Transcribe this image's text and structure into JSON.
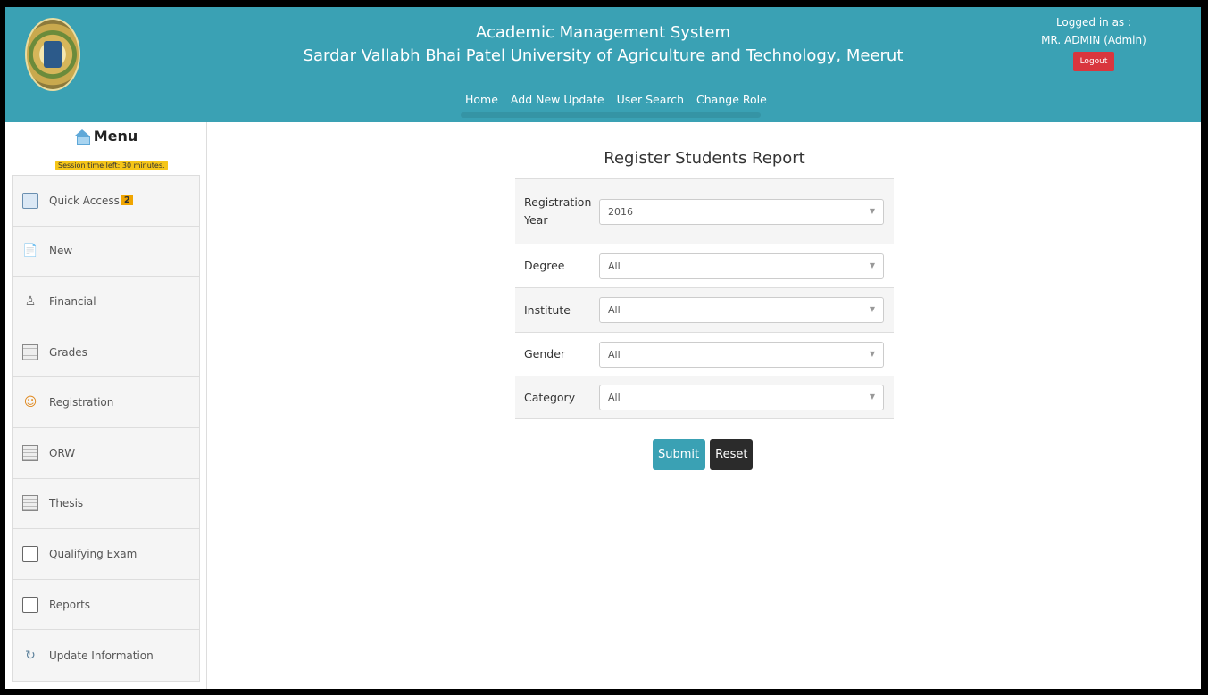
{
  "header": {
    "app_title": "Academic Management System",
    "university": "Sardar Vallabh Bhai Patel University of Agriculture and Technology, Meerut",
    "nav": [
      "Home",
      "Add New Update",
      "User Search",
      "Change Role"
    ],
    "logged_in_label": "Logged in as :",
    "user": "MR. ADMIN (Admin)",
    "logout_label": "Logout"
  },
  "sidebar": {
    "title": "Menu",
    "session": "Session time left: 30 minutes.",
    "items": [
      {
        "label": "Quick Access",
        "badge": "2",
        "icon": "quick-access-icon"
      },
      {
        "label": "New",
        "icon": "new-icon"
      },
      {
        "label": "Financial",
        "icon": "financial-icon"
      },
      {
        "label": "Grades",
        "icon": "grades-icon"
      },
      {
        "label": "Registration",
        "icon": "registration-icon"
      },
      {
        "label": "ORW",
        "icon": "orw-icon"
      },
      {
        "label": "Thesis",
        "icon": "thesis-icon"
      },
      {
        "label": "Qualifying Exam",
        "icon": "qualifying-exam-icon"
      },
      {
        "label": "Reports",
        "icon": "reports-icon"
      },
      {
        "label": "Update Information",
        "icon": "update-information-icon"
      }
    ]
  },
  "report": {
    "title": "Register Students Report",
    "fields": [
      {
        "label": "Registration Year",
        "value": "2016"
      },
      {
        "label": "Degree",
        "value": "All"
      },
      {
        "label": "Institute",
        "value": "All"
      },
      {
        "label": "Gender",
        "value": "All"
      },
      {
        "label": "Category",
        "value": "All"
      }
    ],
    "submit_label": "Submit",
    "reset_label": "Reset"
  },
  "colors": {
    "header": "#3aa1b4",
    "logout": "#d9363e",
    "badge": "#f0a500",
    "reset": "#2b2b2b"
  }
}
